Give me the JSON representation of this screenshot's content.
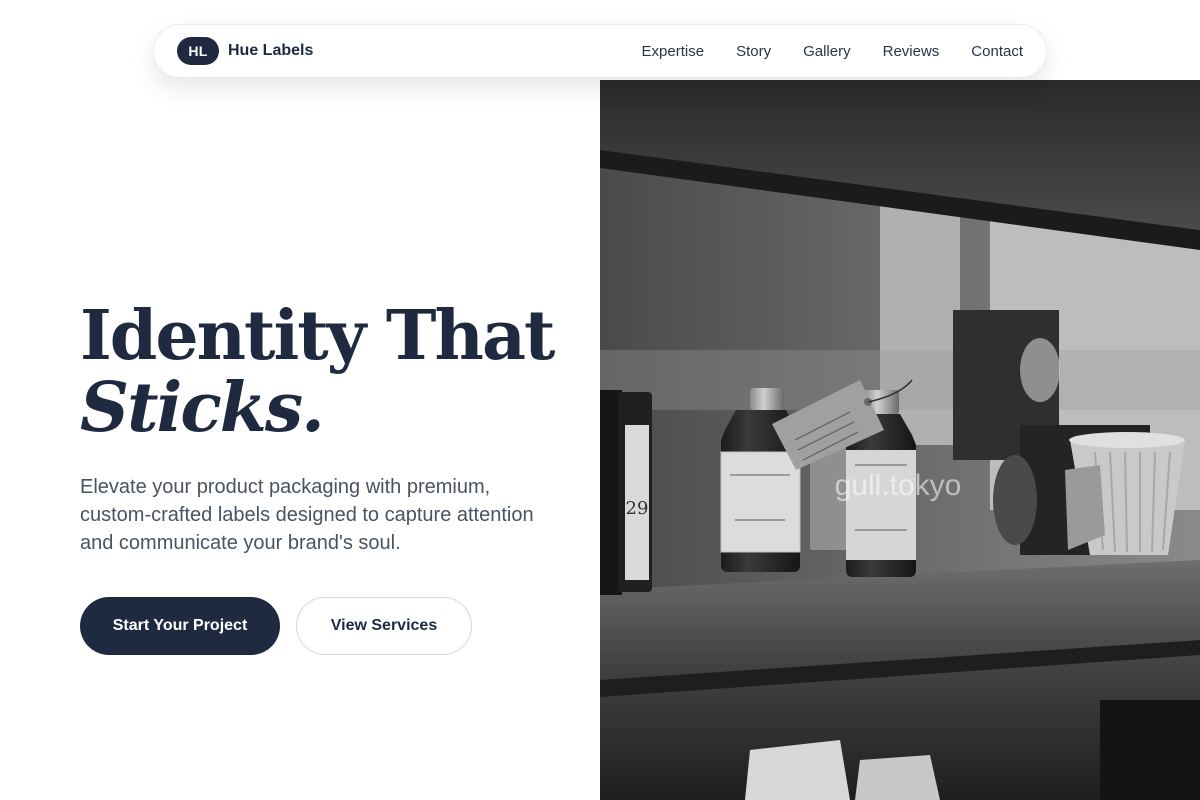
{
  "nav": {
    "logo_initials": "HL",
    "brand_name": "Hue Labels",
    "links": [
      {
        "label": "Expertise"
      },
      {
        "label": "Story"
      },
      {
        "label": "Gallery"
      },
      {
        "label": "Reviews"
      },
      {
        "label": "Contact"
      }
    ]
  },
  "hero": {
    "title_line1": "Identity That",
    "title_line2": "Sticks.",
    "subtitle": "Elevate your product packaging with premium, custom-crafted labels designed to capture attention and communicate your brand's soul.",
    "primary_cta": "Start Your Project",
    "secondary_cta": "View Services"
  },
  "image": {
    "watermark": "gull.tokyo",
    "bottle_label_number": "29"
  },
  "colors": {
    "primary": "#1f2a40",
    "text_muted": "#4a5263",
    "background": "#ffffff"
  }
}
